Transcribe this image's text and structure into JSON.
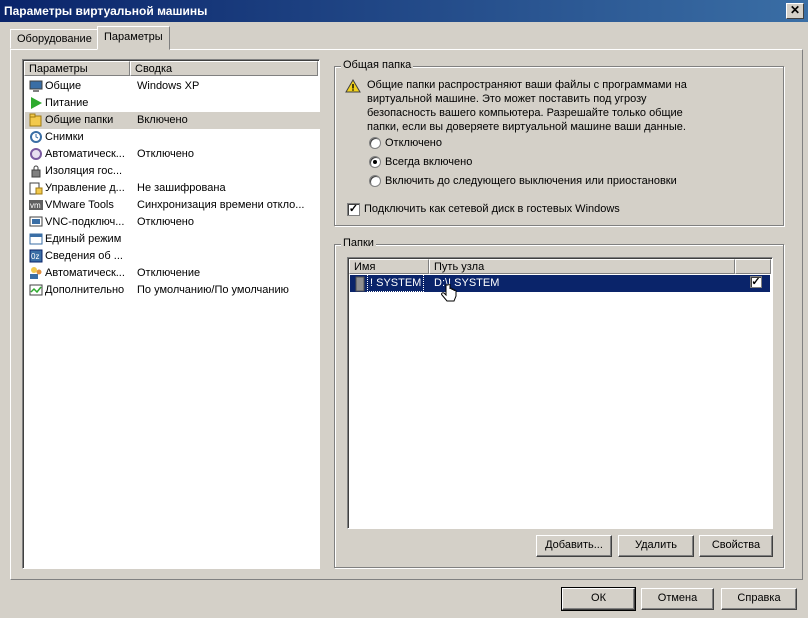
{
  "window": {
    "title": "Параметры виртуальной машины",
    "close": "✕"
  },
  "tabs": [
    {
      "label": "Оборудование",
      "active": false
    },
    {
      "label": "Параметры",
      "active": true
    }
  ],
  "settings_list": {
    "columns": [
      "Параметры",
      "Сводка"
    ],
    "items": [
      {
        "name": "Общие",
        "summary": "Windows XP",
        "icon": "monitor-icon"
      },
      {
        "name": "Питание",
        "summary": "",
        "icon": "play-icon"
      },
      {
        "name": "Общие папки",
        "summary": "Включено",
        "icon": "shared-folder-icon",
        "selected": true
      },
      {
        "name": "Снимки",
        "summary": "",
        "icon": "snapshot-icon"
      },
      {
        "name": "Автоматическ...",
        "summary": "Отключено",
        "icon": "autoprotect-icon"
      },
      {
        "name": "Изоляция гос...",
        "summary": "",
        "icon": "lock-icon"
      },
      {
        "name": "Управление д...",
        "summary": "Не зашифрована",
        "icon": "access-control-icon"
      },
      {
        "name": "VMware Tools",
        "summary": "Синхронизация времени откло...",
        "icon": "vmware-icon"
      },
      {
        "name": "VNC-подключ...",
        "summary": "Отключено",
        "icon": "vnc-icon"
      },
      {
        "name": "Единый режим",
        "summary": "",
        "icon": "unity-icon"
      },
      {
        "name": "Сведения об ...",
        "summary": "",
        "icon": "info-icon"
      },
      {
        "name": "Автоматическ...",
        "summary": "Отключение",
        "icon": "users-icon"
      },
      {
        "name": "Дополнительно",
        "summary": "По умолчанию/По умолчанию",
        "icon": "advanced-icon"
      }
    ]
  },
  "shared_folders": {
    "legend": "Общая папка",
    "warning": "Общие папки распространяют ваши файлы с программами на виртуальной машине. Это может поставить под угрозу безопасность вашего компьютера. Разрешайте только общие папки, если вы доверяете виртуальной машине ваши данные.",
    "options": [
      {
        "label": "Отключено",
        "selected": false
      },
      {
        "label": "Всегда включено",
        "selected": true
      },
      {
        "label": "Включить до следующего выключения или приостановки",
        "selected": false
      }
    ],
    "map_drive_label": "Подключить как сетевой диск в гостевых Windows",
    "map_drive_checked": true
  },
  "folders": {
    "legend": "Папки",
    "columns": [
      "Имя",
      "Путь узла"
    ],
    "rows": [
      {
        "name": "! SYSTEM",
        "path": "D:\\! SYSTEM",
        "enabled": true
      }
    ],
    "buttons": {
      "add": "Добавить...",
      "remove": "Удалить",
      "properties": "Свойства"
    }
  },
  "dialog_buttons": {
    "ok": "ОК",
    "cancel": "Отмена",
    "help": "Справка"
  },
  "colors": {
    "title_bar": "#0a246a",
    "selection": "#0a246a",
    "face": "#d4d0c8"
  }
}
